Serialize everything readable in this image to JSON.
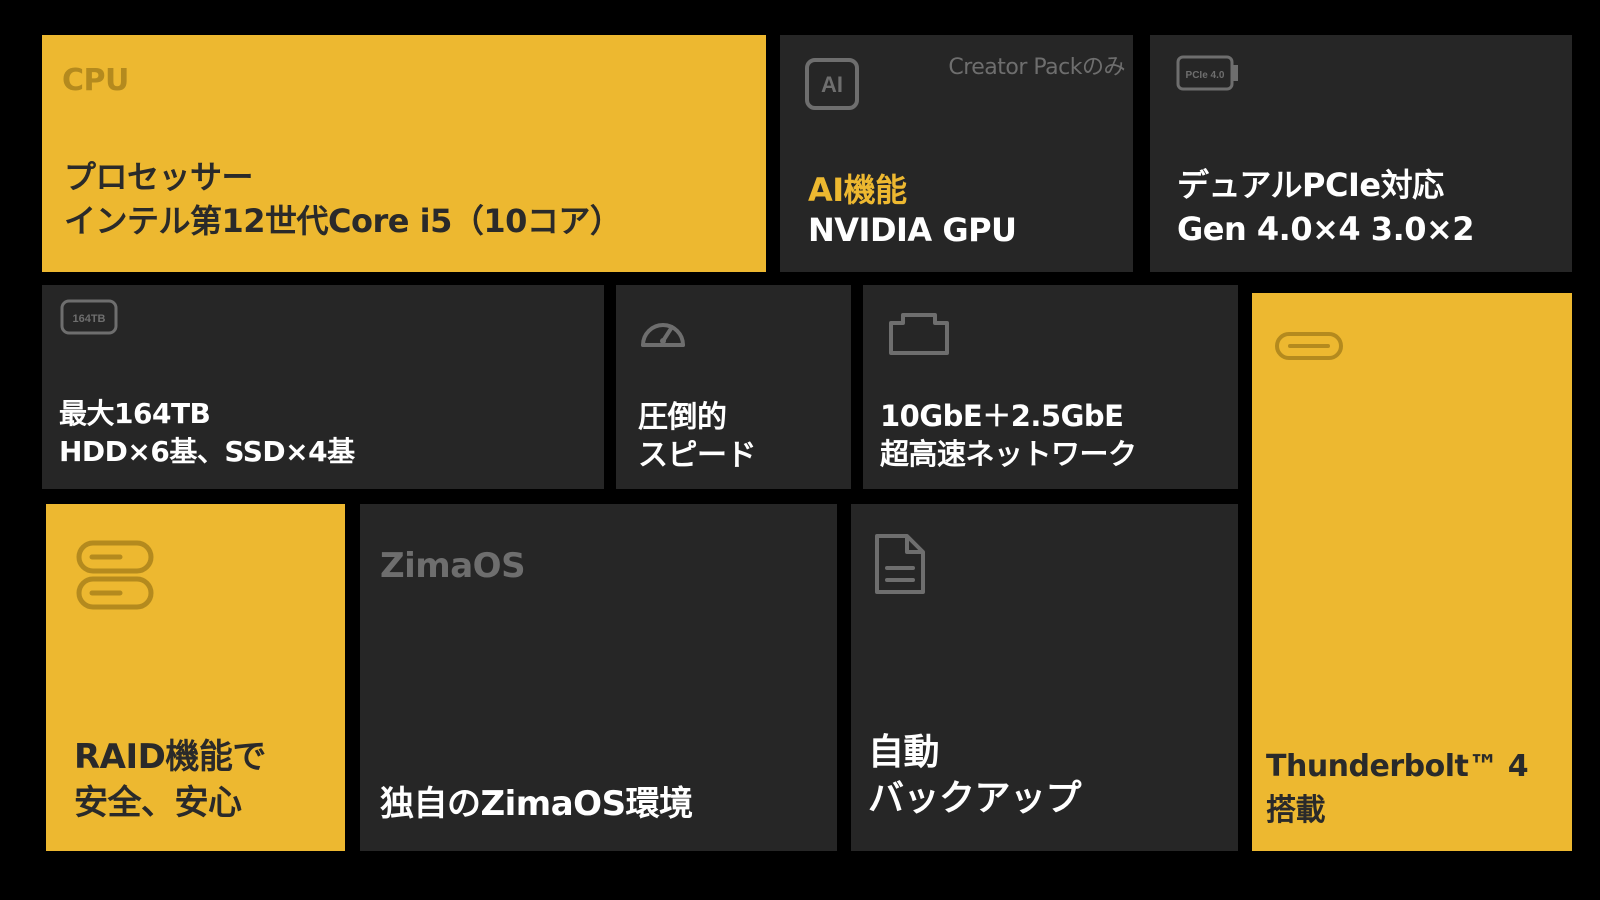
{
  "colors": {
    "background": "#000000",
    "tile_dark": "#262626",
    "tile_gold": "#EDB830",
    "text_white": "#FFFFFF",
    "text_ink": "#2A2A2A",
    "text_muted": "#6E6E6E",
    "accent": "#EDB830"
  },
  "tiles": {
    "cpu": {
      "label": "CPU",
      "line1": "プロセッサー",
      "line2": "インテル第12世代Core i5（10コア）"
    },
    "ai": {
      "icon": "ai-chip-icon",
      "icon_text": "AI",
      "badge": "Creator Packのみ",
      "title": "AI機能",
      "subtitle": "NVIDIA GPU"
    },
    "pcie": {
      "icon": "pcie-card-icon",
      "icon_text": "PCIe 4.0",
      "line1": "デュアルPCIe対応",
      "line2": "Gen 4.0×4  3.0×2"
    },
    "storage": {
      "icon": "drive-icon",
      "icon_text": "164TB",
      "line1": "最大164TB",
      "line2": "HDD×6基、SSD×4基"
    },
    "speed": {
      "icon": "speedometer-icon",
      "line1": "圧倒的",
      "line2": "スピード"
    },
    "network": {
      "icon": "ethernet-port-icon",
      "line1": "10GbE＋2.5GbE",
      "line2": "超高速ネットワーク"
    },
    "thunderbolt": {
      "icon": "usb-c-port-icon",
      "line1": "Thunderbolt™ 4",
      "line2": "搭載"
    },
    "raid": {
      "icon": "server-stack-icon",
      "line1": "RAID機能で",
      "line2": "安全、安心"
    },
    "zimaos": {
      "logo_text": "ZimaOS",
      "caption": "独自のZimaOS環境"
    },
    "backup": {
      "icon": "document-icon",
      "line1": "自動",
      "line2": "バックアップ"
    }
  }
}
